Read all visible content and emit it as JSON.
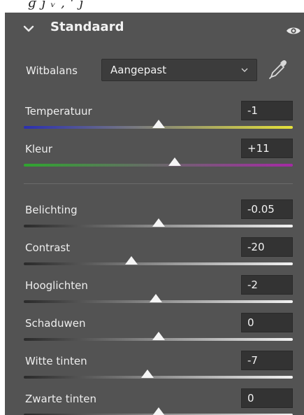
{
  "section": {
    "title": "Standaard"
  },
  "white_balance": {
    "label": "Witbalans",
    "selected": "Aangepast"
  },
  "color_sliders": [
    {
      "label": "Temperatuur",
      "value": "-1",
      "position": 0.5
    },
    {
      "label": "Kleur",
      "value": "+11",
      "position": 0.56
    }
  ],
  "tone_sliders": [
    {
      "label": "Belichting",
      "value": "-0.05",
      "position": 0.5
    },
    {
      "label": "Contrast",
      "value": "-20",
      "position": 0.4
    },
    {
      "label": "Hooglichten",
      "value": "-2",
      "position": 0.49
    },
    {
      "label": "Schaduwen",
      "value": "0",
      "position": 0.5
    },
    {
      "label": "Witte tinten",
      "value": "-7",
      "position": 0.46
    },
    {
      "label": "Zwarte tinten",
      "value": "0",
      "position": 0.5
    }
  ],
  "colors": {
    "panel_bg": "#535353",
    "field_bg": "#333333",
    "temperature_gradient": [
      "#2a2fb0",
      "#e6e23a"
    ],
    "tint_gradient": [
      "#2fa52f",
      "#a52aa5"
    ],
    "tone_gradient": [
      "#2a2a2a",
      "#f2f2f2"
    ]
  },
  "icons": {
    "collapse": "chevron-down-icon",
    "visibility": "eye-icon",
    "picker": "eyedropper-icon",
    "dropdown": "caret-down-icon"
  }
}
